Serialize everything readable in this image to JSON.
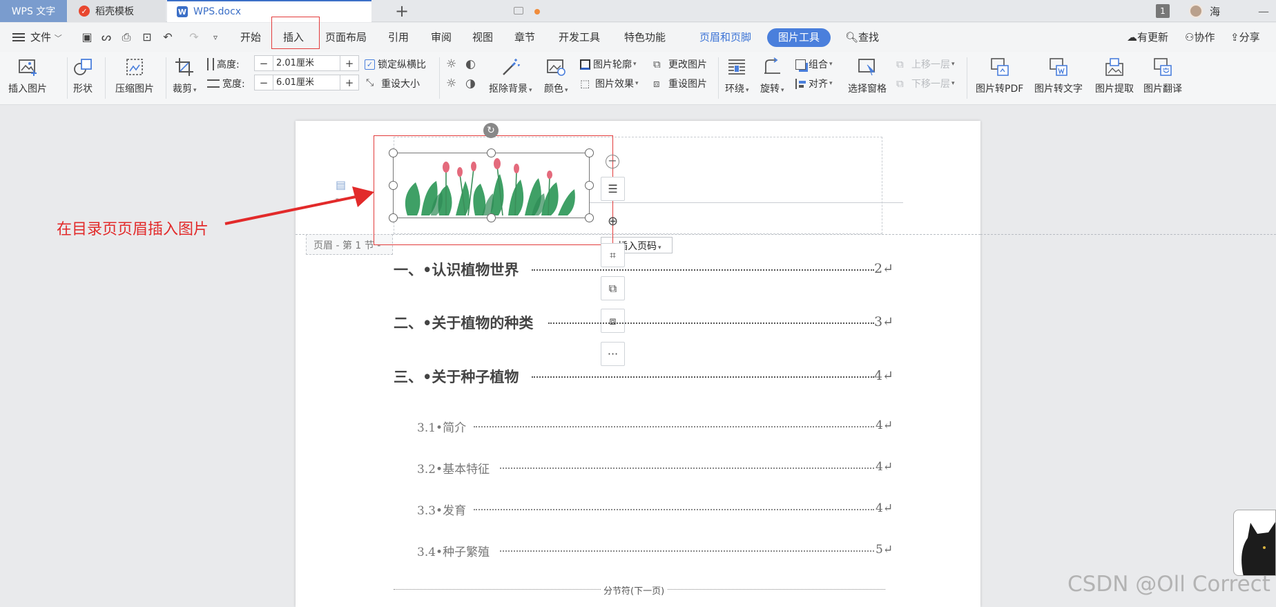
{
  "titlebar": {
    "tabs": [
      {
        "label": "WPS 文字"
      },
      {
        "label": "稻壳模板",
        "icon": "daoke-logo-icon"
      },
      {
        "label": "WPS.docx",
        "icon": "wps-writer-icon"
      }
    ],
    "badge": "1",
    "username": "海",
    "minimize": "—",
    "plus": "+"
  },
  "menubar": {
    "file": "文件",
    "tabs": [
      "开始",
      "插入",
      "页面布局",
      "引用",
      "审阅",
      "视图",
      "章节",
      "开发工具",
      "特色功能"
    ],
    "header_footer": "页眉和页脚",
    "picture_tools": "图片工具",
    "search": "查找",
    "right": [
      "有更新",
      "协作",
      "分享"
    ]
  },
  "ribbon": {
    "insert_picture": "插入图片",
    "shape": "形状",
    "compress": "压缩图片",
    "crop": "裁剪",
    "height_label": "高度:",
    "height_value": "2.01厘米",
    "width_label": "宽度:",
    "width_value": "6.01厘米",
    "lock_ratio": "锁定纵横比",
    "reset_size": "重设大小",
    "remove_bg": "抠除背景",
    "color": "颜色",
    "outline": "图片轮廓",
    "effects": "图片效果",
    "change_pic": "更改图片",
    "reset_pic": "重设图片",
    "wrap": "环绕",
    "rotate": "旋转",
    "group": "组合",
    "align": "对齐",
    "select_pane": "选择窗格",
    "bring_forward": "上移一层",
    "send_backward": "下移一层",
    "to_pdf": "图片转PDF",
    "to_text": "图片转文字",
    "extract": "图片提取",
    "translate": "图片翻译",
    "minus": "−",
    "plus": "+"
  },
  "document": {
    "header_label": "页眉 - 第 1 节 -",
    "insert_page_number": "插入页码",
    "toc": [
      {
        "text": "一、•认识植物世界",
        "page": "2↵"
      },
      {
        "text": "二、•关于植物的种类",
        "page": "3↵"
      },
      {
        "text": "三、•关于种子植物",
        "page": "4↵"
      },
      {
        "text": "3.1•简介",
        "page": "4↵"
      },
      {
        "text": "3.2•基本特征",
        "page": "4↵"
      },
      {
        "text": "3.3•发育",
        "page": "4↵"
      },
      {
        "text": "3.4•种子繁殖",
        "page": "5↵"
      }
    ],
    "section_break": "分节符(下一页)",
    "more": "···"
  },
  "annotation": "在目录页页眉插入图片",
  "watermark": "CSDN @Oll Correct",
  "colors": {
    "accent": "#4a7fdc",
    "annotation_red": "#e22a2a",
    "title_blue": "#3b6fc7"
  }
}
